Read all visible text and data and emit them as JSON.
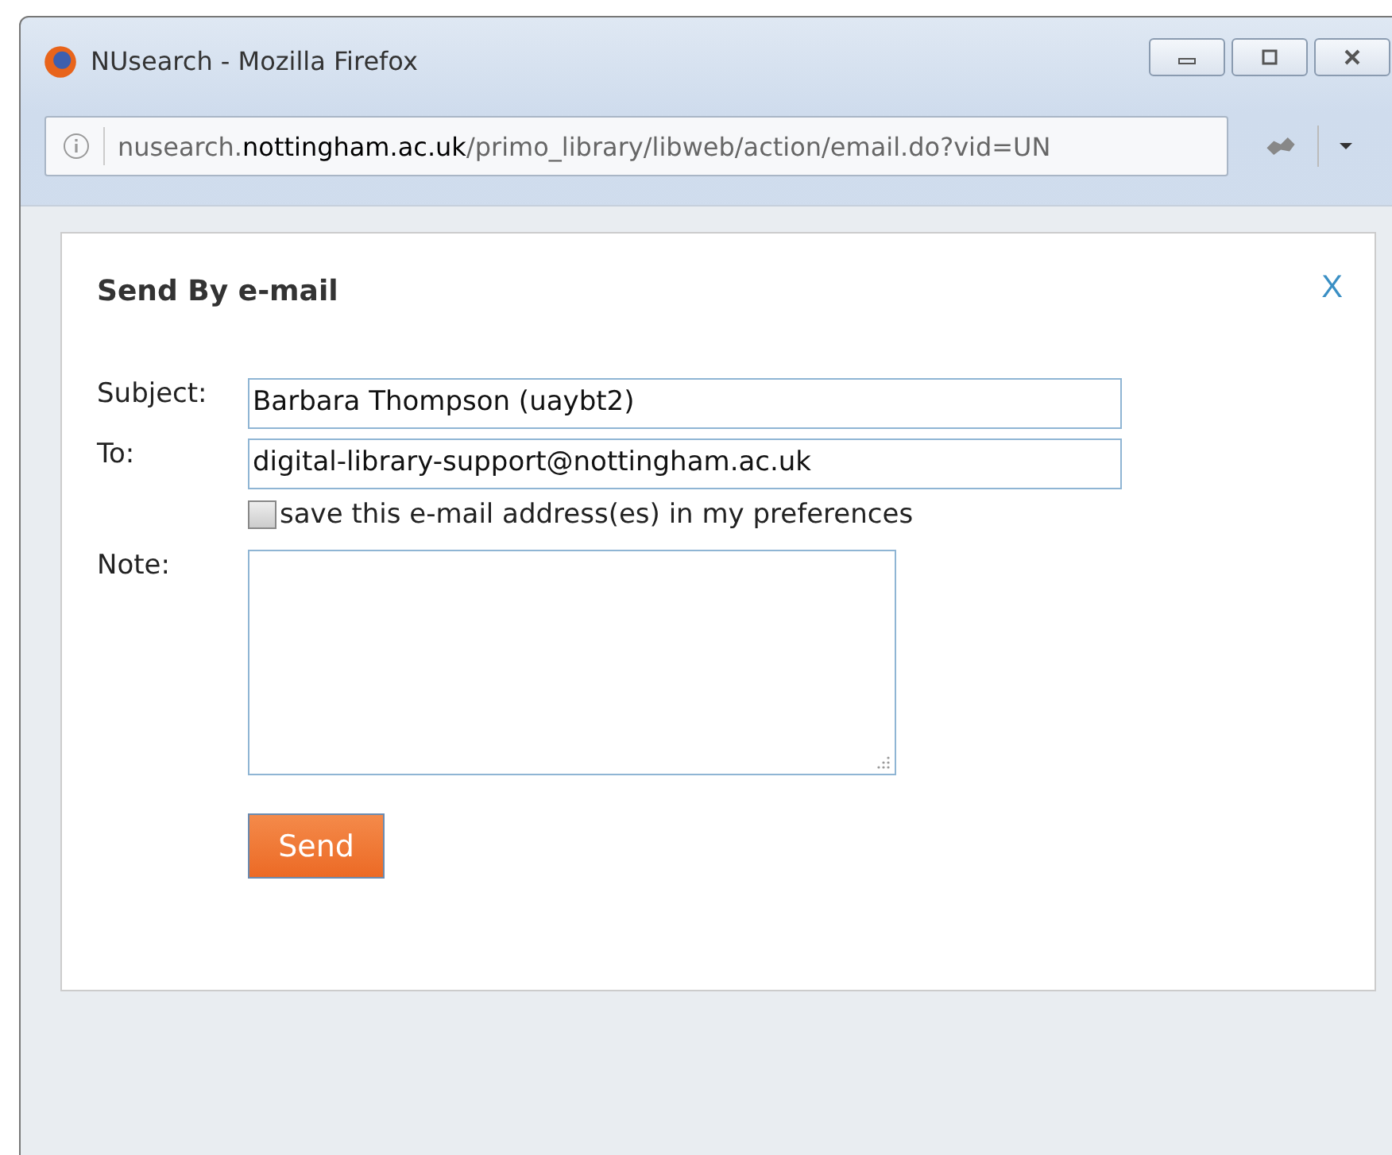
{
  "window": {
    "title": "NUsearch - Mozilla Firefox"
  },
  "address_bar": {
    "url": "nusearch.**nottingham.ac.uk**/primo_library/libweb/action/email.do?vid=UN"
  },
  "dialog": {
    "title": "Send By e-mail",
    "close": "X",
    "fields": [
      {
        "kind": "input",
        "label": "Subject:",
        "value": "Barbara Thompson (uaybt2)"
      },
      {
        "kind": "input",
        "label": "To:",
        "value": "digital-library-support@nottingham.ac.uk"
      },
      {
        "kind": "checkbox",
        "label": "save this e-mail address(es) in my preferences",
        "checked": false
      },
      {
        "kind": "textarea",
        "label": "Note:"
      }
    ],
    "send_button": "Send"
  }
}
